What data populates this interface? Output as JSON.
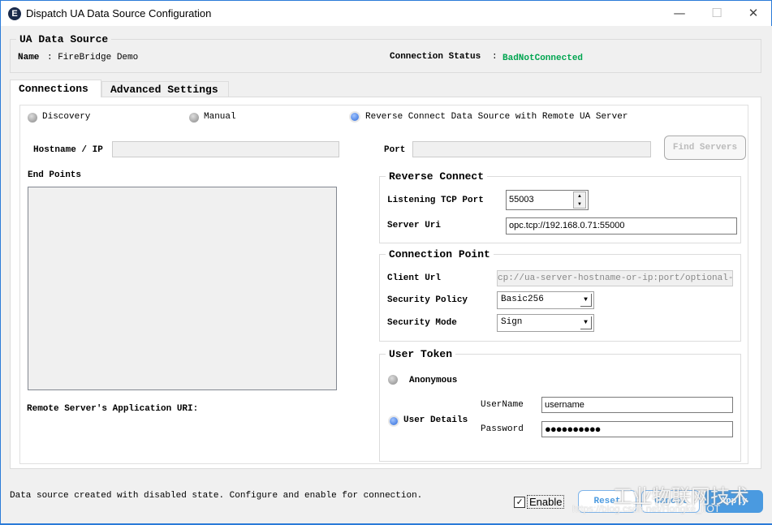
{
  "window": {
    "title": "Dispatch UA Data Source Configuration",
    "app_icon_letter": "E",
    "minimize": "—",
    "maximize": "☐",
    "close": "✕"
  },
  "source": {
    "legend": "UA Data Source",
    "name_label": "Name",
    "name_value": ": FireBridge Demo",
    "status_label": "Connection Status",
    "status_sep": ":",
    "status_value": "BadNotConnected",
    "status_color": "#00a550"
  },
  "tabs": [
    {
      "label": "Connections",
      "active": true
    },
    {
      "label": "Advanced Settings",
      "active": false
    }
  ],
  "connections": {
    "modes": [
      {
        "label": "Discovery",
        "selected": false
      },
      {
        "label": "Manual",
        "selected": false
      },
      {
        "label": "Reverse Connect Data Source with Remote UA Server",
        "selected": true
      }
    ],
    "hostname_label": "Hostname / IP",
    "hostname_value": "",
    "port_label": "Port",
    "port_value": "",
    "find_servers": "Find Servers",
    "endpoints_label": "End Points",
    "remote_uri_label": "Remote Server's Application URI:",
    "reverse": {
      "legend": "Reverse Connect",
      "tcp_port_label": "Listening TCP Port",
      "tcp_port_value": "55003",
      "server_uri_label": "Server Uri",
      "server_uri_value": "opc.tcp://192.168.0.71:55000"
    },
    "point": {
      "legend": "Connection Point",
      "client_url_label": "Client Url",
      "client_url_value": "cp://ua-server-hostname-or-ip:port/optional-path",
      "policy_label": "Security Policy",
      "policy_value": "Basic256",
      "mode_label": "Security Mode",
      "mode_value": "Sign"
    },
    "token": {
      "legend": "User Token",
      "anonymous": "Anonymous",
      "anonymous_selected": false,
      "user_details": "User Details",
      "user_details_selected": true,
      "username_label": "UserName",
      "username_value": "username",
      "password_label": "Password",
      "password_value": "●●●●●●●●●●"
    }
  },
  "footer": {
    "status": "Data source created with disabled state. Configure and enable for connection.",
    "enable_label": "Enable",
    "enable_checked": true,
    "reset": "Reset",
    "cancel": "Cancel",
    "apply": "Apply"
  },
  "watermark": {
    "text": "工业物联网技术",
    "url": "https://blog.csdn.net/Hongke_IIOT"
  }
}
